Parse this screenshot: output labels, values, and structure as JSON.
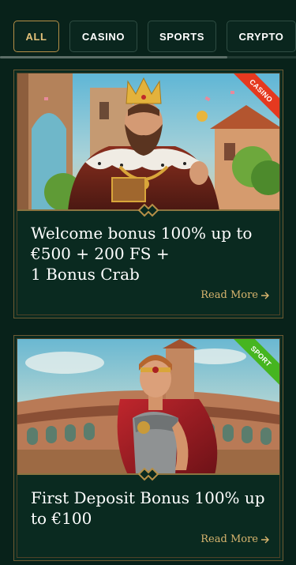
{
  "tabs": [
    {
      "label": "ALL",
      "active": true
    },
    {
      "label": "CASINO",
      "active": false
    },
    {
      "label": "SPORTS",
      "active": false
    },
    {
      "label": "CRYPTO",
      "active": false
    }
  ],
  "cards": [
    {
      "badge": "CASINO",
      "badge_color": "#e5391f",
      "title_lines": [
        "Welcome bonus 100% up to",
        "€500 + 200 FS +",
        "1 Bonus Crab"
      ],
      "read_more": "Read More"
    },
    {
      "badge": "SPORT",
      "badge_color": "#46b520",
      "title_lines": [
        "First Deposit Bonus 100% up",
        "to €100"
      ],
      "read_more": "Read More"
    }
  ],
  "colors": {
    "background": "#08221a",
    "accent_gold": "#d8b56e",
    "card_border": "#6d5a33"
  }
}
